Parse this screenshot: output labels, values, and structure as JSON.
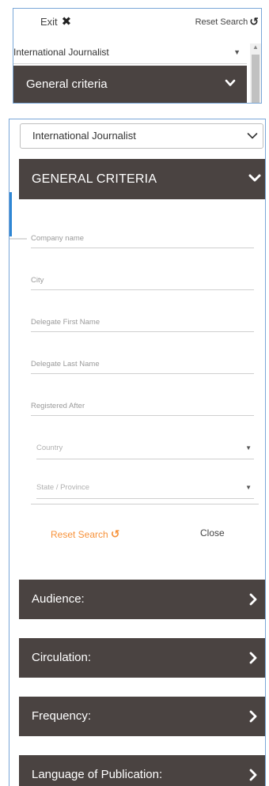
{
  "mini": {
    "exit_label": "Exit",
    "exit_icon": "close-icon",
    "reset_label": "Reset Search",
    "reset_icon": "undo-icon",
    "category_value": "International Journalist",
    "header_label": "General criteria"
  },
  "main": {
    "category_value": "International Journalist",
    "header_label": "GENERAL CRITERIA",
    "fields": {
      "company": "Company name",
      "city": "City",
      "delegate_first": "Delegate First Name",
      "delegate_last": "Delegate Last Name",
      "registered_after": "Registered After"
    },
    "country_placeholder": "Country",
    "state_placeholder": "State / Province",
    "reset_label": "Reset Search",
    "close_label": "Close",
    "sections": [
      "Audience:",
      "Circulation:",
      "Frequency:",
      "Language of Publication:"
    ]
  },
  "colors": {
    "bar_bg": "#4a4341",
    "accent_blue": "#2f86d4",
    "reset_orange": "#f7923a"
  }
}
